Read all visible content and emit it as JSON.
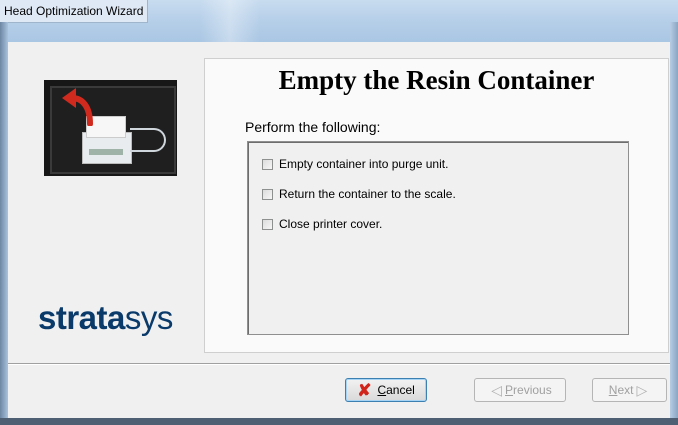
{
  "window": {
    "title": "Head Optimization Wizard"
  },
  "page": {
    "heading": "Empty the Resin Container",
    "instruction": "Perform the following:",
    "steps": [
      {
        "label": "Empty container into purge unit.",
        "checked": false
      },
      {
        "label": "Return the container to the scale.",
        "checked": false
      },
      {
        "label": "Close printer cover.",
        "checked": false
      }
    ]
  },
  "logo": {
    "bold": "strata",
    "rest": "sys"
  },
  "buttons": {
    "cancel": {
      "accel": "C",
      "rest": "ancel"
    },
    "previous": {
      "accel": "P",
      "rest": "revious"
    },
    "next": {
      "accel": "N",
      "rest": "ext"
    }
  },
  "icons": {
    "cancel": "x-icon",
    "previous": "arrow-left-icon",
    "next": "arrow-right-icon"
  },
  "colors": {
    "logo": "#0a3a6a",
    "cancel_x": "#d1241a"
  }
}
